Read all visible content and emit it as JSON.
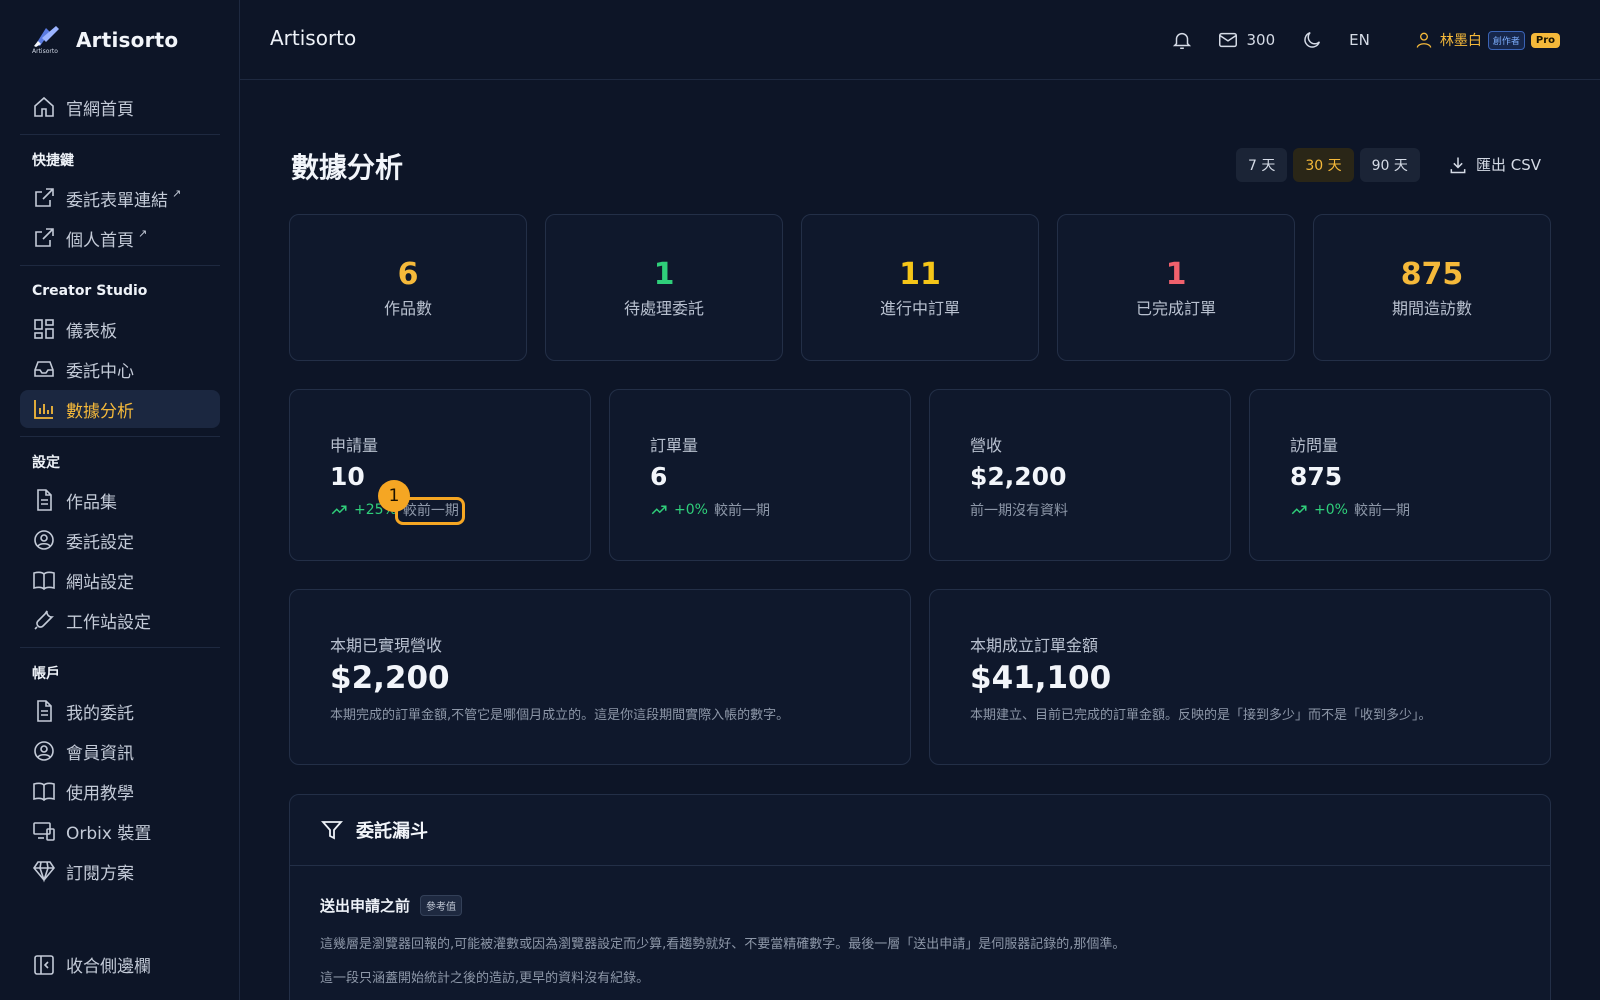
{
  "brand": {
    "name": "Artisorto",
    "logo_sub": "Artisorto"
  },
  "sidebar": {
    "home": "官網首頁",
    "sections": {
      "shortcuts": "快捷鍵",
      "studio": "Creator Studio",
      "settings": "設定",
      "account": "帳戶"
    },
    "shortcuts": [
      "委託表單連結",
      "個人首頁"
    ],
    "ext_mark": "↗",
    "studio": [
      "儀表板",
      "委託中心",
      "數據分析"
    ],
    "settings": [
      "作品集",
      "委託設定",
      "網站設定",
      "工作站設定"
    ],
    "account": [
      "我的委託",
      "會員資訊",
      "使用教學",
      "Orbix 裝置",
      "訂閱方案"
    ],
    "collapse": "收合側邊欄"
  },
  "header": {
    "title": "Artisorto",
    "mail_count": "300",
    "lang": "EN",
    "user_name": "林墨白",
    "creator_badge": "創作者",
    "pro_badge": "Pro"
  },
  "page": {
    "title": "數據分析",
    "ranges": [
      "7 天",
      "30 天",
      "90 天"
    ],
    "active_range": "30 天",
    "export_label": "匯出 CSV"
  },
  "stats": [
    {
      "value": "6",
      "label": "作品數",
      "color": "#f5b93a"
    },
    {
      "value": "1",
      "label": "待處理委託",
      "color": "#2fce7a"
    },
    {
      "value": "11",
      "label": "進行中訂單",
      "color": "#f5c518"
    },
    {
      "value": "1",
      "label": "已完成訂單",
      "color": "#f0616d"
    },
    {
      "value": "875",
      "label": "期間造訪數",
      "color": "#f5b93a"
    }
  ],
  "metrics": [
    {
      "label": "申請量",
      "value": "10",
      "delta": "+25%",
      "compare": "較前一期"
    },
    {
      "label": "訂單量",
      "value": "6",
      "delta": "+0%",
      "compare": "較前一期"
    },
    {
      "label": "營收",
      "value": "$2,200",
      "note": "前一期沒有資料"
    },
    {
      "label": "訪問量",
      "value": "875",
      "delta": "+0%",
      "compare": "較前一期"
    }
  ],
  "revenue": [
    {
      "label": "本期已實現營收",
      "value": "$2,200",
      "desc": "本期完成的訂單金額,不管它是哪個月成立的。這是你這段期間實際入帳的數字。"
    },
    {
      "label": "本期成立訂單金額",
      "value": "$41,100",
      "desc": "本期建立、目前已完成的訂單金額。反映的是「接到多少」而不是「收到多少」。"
    }
  ],
  "funnel": {
    "title": "委託漏斗",
    "subtitle": "送出申請之前",
    "tag": "參考值",
    "note1": "這幾層是瀏覽器回報的,可能被灌數或因為瀏覽器設定而少算,看趨勢就好、不要當精確數字。最後一層「送出申請」是伺服器記錄的,那個準。",
    "note2": "這一段只涵蓋開始統計之後的造訪,更早的資料沒有紀錄。"
  },
  "annotation": {
    "number": "1"
  }
}
